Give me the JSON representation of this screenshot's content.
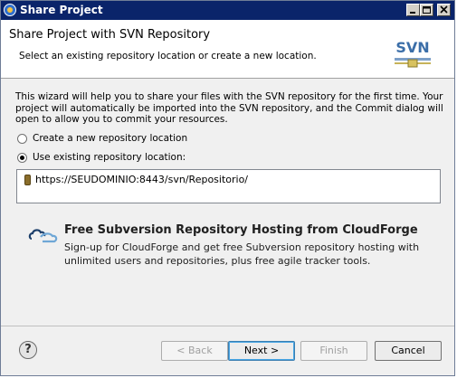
{
  "window": {
    "title": "Share Project"
  },
  "header": {
    "heading": "Share Project with SVN Repository",
    "subheading": "Select an existing repository location or create a new location.",
    "logo_text": "SVN"
  },
  "main": {
    "description": "This wizard will help you to share your files with the SVN repository for the first time. Your project will automatically be imported into the SVN repository, and the Commit dialog will open to allow you to commit your resources.",
    "options": [
      {
        "label": "Create a new repository location",
        "selected": false
      },
      {
        "label": "Use existing repository location:",
        "selected": true
      }
    ],
    "repositories": [
      {
        "url": "https://SEUDOMINIO:8443/svn/Repositorio/"
      }
    ]
  },
  "promo": {
    "title": "Free Subversion Repository Hosting from CloudForge",
    "text": "Sign-up for CloudForge and get free Subversion repository hosting with unlimited users and repositories, plus free agile tracker tools."
  },
  "footer": {
    "help": "?",
    "back_label": "< Back",
    "next_label": "Next >",
    "finish_label": "Finish",
    "cancel_label": "Cancel"
  },
  "colors": {
    "titlebar": "#0a246a",
    "accent": "#3c7fb1"
  }
}
